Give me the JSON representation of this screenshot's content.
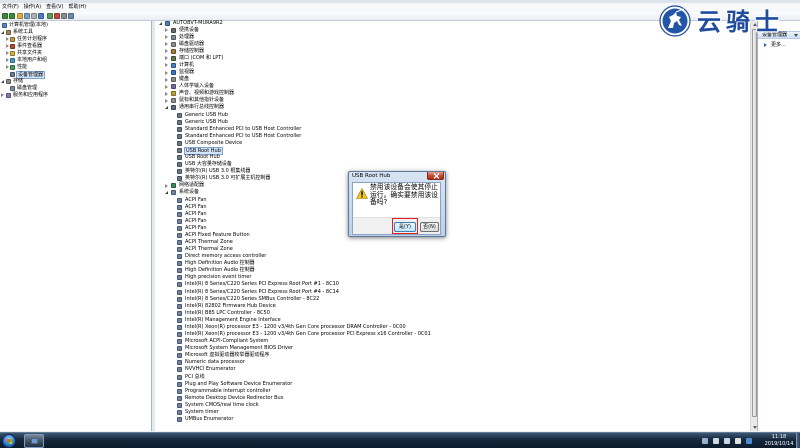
{
  "menu": {
    "items": [
      "文件(F)",
      "操作(A)",
      "查看(V)",
      "帮助(H)"
    ]
  },
  "toolbar": {
    "icons": [
      "back-icon",
      "forward-icon",
      "up-level-icon",
      "show-hide-console-tree-icon",
      "properties-icon",
      "help-icon",
      "update-driver-icon",
      "uninstall-device-icon",
      "disable-device-icon",
      "scan-hardware-changes-icon"
    ]
  },
  "left_tree": [
    {
      "label": "计算机管理(本地)",
      "level": 0,
      "icon": "computer-management-icon"
    },
    {
      "label": "系统工具",
      "level": 1,
      "state": "expanded",
      "icon": "system-tools-icon"
    },
    {
      "label": "任务计划程序",
      "level": 2,
      "state": "collapsed",
      "icon": "task-scheduler-icon"
    },
    {
      "label": "事件查看器",
      "level": 2,
      "state": "collapsed",
      "icon": "event-viewer-icon"
    },
    {
      "label": "共享文件夹",
      "level": 2,
      "state": "collapsed",
      "icon": "shared-folders-icon"
    },
    {
      "label": "本地用户和组",
      "level": 2,
      "state": "collapsed",
      "icon": "local-users-icon"
    },
    {
      "label": "性能",
      "level": 2,
      "state": "collapsed",
      "icon": "performance-icon"
    },
    {
      "label": "设备管理器",
      "level": 2,
      "icon": "device-manager-icon",
      "selected": true
    },
    {
      "label": "存储",
      "level": 1,
      "state": "expanded",
      "icon": "storage-icon"
    },
    {
      "label": "磁盘管理",
      "level": 2,
      "icon": "disk-management-icon"
    },
    {
      "label": "服务和应用程序",
      "level": 1,
      "state": "collapsed",
      "icon": "services-icon"
    }
  ],
  "device_tree": {
    "rows": [
      {
        "label": "AUTOBVT-MURA9R2",
        "level": 0,
        "state": "expanded",
        "icon": "computer-icon"
      },
      {
        "label": "便携设备",
        "level": 1,
        "state": "collapsed",
        "icon": "portable-device-icon"
      },
      {
        "label": "处理器",
        "level": 1,
        "state": "collapsed",
        "icon": "processor-icon"
      },
      {
        "label": "磁盘驱动器",
        "level": 1,
        "state": "collapsed",
        "icon": "disk-drive-icon"
      },
      {
        "label": "存储控制器",
        "level": 1,
        "state": "collapsed",
        "icon": "storage-controller-icon"
      },
      {
        "label": "端口 (COM 和 LPT)",
        "level": 1,
        "state": "collapsed",
        "icon": "port-icon"
      },
      {
        "label": "计算机",
        "level": 1,
        "state": "collapsed",
        "icon": "computer-icon"
      },
      {
        "label": "监视器",
        "level": 1,
        "state": "collapsed",
        "icon": "monitor-icon"
      },
      {
        "label": "键盘",
        "level": 1,
        "state": "collapsed",
        "icon": "keyboard-icon"
      },
      {
        "label": "人体学输入设备",
        "level": 1,
        "state": "collapsed",
        "icon": "hid-icon"
      },
      {
        "label": "声音、视频和游戏控制器",
        "level": 1,
        "state": "collapsed",
        "icon": "sound-icon"
      },
      {
        "label": "鼠标和其他指针设备",
        "level": 1,
        "state": "collapsed",
        "icon": "mouse-icon"
      },
      {
        "label": "通用串行总线控制器",
        "level": 1,
        "state": "expanded",
        "icon": "usb-icon"
      },
      {
        "label": "Generic USB Hub",
        "level": 2,
        "icon": "usb-device-icon"
      },
      {
        "label": "Generic USB Hub",
        "level": 2,
        "icon": "usb-device-icon"
      },
      {
        "label": "Standard Enhanced PCI to USB Host Controller",
        "level": 2,
        "icon": "usb-device-icon"
      },
      {
        "label": "Standard Enhanced PCI to USB Host Controller",
        "level": 2,
        "icon": "usb-device-icon"
      },
      {
        "label": "USB Composite Device",
        "level": 2,
        "icon": "usb-device-icon"
      },
      {
        "label": "USB Root Hub",
        "level": 2,
        "icon": "usb-device-icon",
        "selected": true
      },
      {
        "label": "USB Root Hub",
        "level": 2,
        "icon": "usb-device-icon"
      },
      {
        "label": "USB 大容量存储设备",
        "level": 2,
        "icon": "usb-device-icon"
      },
      {
        "label": "英特尔(R) USB 3.0 根集线器",
        "level": 2,
        "icon": "usb-device-icon"
      },
      {
        "label": "英特尔(R) USB 3.0 可扩展主机控制器",
        "level": 2,
        "icon": "usb-device-icon"
      },
      {
        "label": "网络适配器",
        "level": 1,
        "state": "collapsed",
        "icon": "network-adapter-icon"
      },
      {
        "label": "系统设备",
        "level": 1,
        "state": "expanded",
        "icon": "system-device-icon"
      },
      {
        "label": "ACPI Fan",
        "level": 2,
        "icon": "system-device-icon"
      },
      {
        "label": "ACPI Fan",
        "level": 2,
        "icon": "system-device-icon"
      },
      {
        "label": "ACPI Fan",
        "level": 2,
        "icon": "system-device-icon"
      },
      {
        "label": "ACPI Fan",
        "level": 2,
        "icon": "system-device-icon"
      },
      {
        "label": "ACPI Fan",
        "level": 2,
        "icon": "system-device-icon"
      },
      {
        "label": "ACPI Fixed Feature Button",
        "level": 2,
        "icon": "system-device-icon"
      },
      {
        "label": "ACPI Thermal Zone",
        "level": 2,
        "icon": "system-device-icon"
      },
      {
        "label": "ACPI Thermal Zone",
        "level": 2,
        "icon": "system-device-icon"
      },
      {
        "label": "Direct memory access controller",
        "level": 2,
        "icon": "system-device-icon"
      },
      {
        "label": "High Definition Audio 控制器",
        "level": 2,
        "icon": "system-device-icon"
      },
      {
        "label": "High Definition Audio 控制器",
        "level": 2,
        "icon": "system-device-icon"
      },
      {
        "label": "High precision event timer",
        "level": 2,
        "icon": "system-device-icon"
      },
      {
        "label": "Intel(R) 8 Series/C220 Series PCI Express Root Port #1 - 8C10",
        "level": 2,
        "icon": "system-device-icon"
      },
      {
        "label": "Intel(R) 8 Series/C220 Series PCI Express Root Port #4 - 8C14",
        "level": 2,
        "icon": "system-device-icon"
      },
      {
        "label": "Intel(R) 8 Series/C220 Series SMBus Controller - 8C22",
        "level": 2,
        "icon": "system-device-icon"
      },
      {
        "label": "Intel(R) 82802 Firmware Hub Device",
        "level": 2,
        "icon": "system-device-icon"
      },
      {
        "label": "Intel(R) B85 LPC Controller - 8C50",
        "level": 2,
        "icon": "system-device-icon"
      },
      {
        "label": "Intel(R) Management Engine Interface",
        "level": 2,
        "icon": "system-device-icon"
      },
      {
        "label": "Intel(R) Xeon(R) processor E3 - 1200 v3/4th Gen Core processor DRAM Controller - 0C00",
        "level": 2,
        "icon": "system-device-icon"
      },
      {
        "label": "Intel(R) Xeon(R) processor E3 - 1200 v3/4th Gen Core processor PCI Express x16 Controller - 0C01",
        "level": 2,
        "icon": "system-device-icon"
      },
      {
        "label": "Microsoft ACPI-Compliant System",
        "level": 2,
        "icon": "system-device-icon"
      },
      {
        "label": "Microsoft System Management BIOS Driver",
        "level": 2,
        "icon": "system-device-icon"
      },
      {
        "label": "Microsoft 虚拟驱动器枚举器驱动程序",
        "level": 2,
        "icon": "system-device-icon"
      },
      {
        "label": "Numeric data processor",
        "level": 2,
        "icon": "system-device-icon"
      },
      {
        "label": "NVVHCI Enumerator",
        "level": 2,
        "icon": "system-device-icon"
      },
      {
        "label": "PCI 总线",
        "level": 2,
        "icon": "system-device-icon"
      },
      {
        "label": "Plug and Play Software Device Enumerator",
        "level": 2,
        "icon": "system-device-icon"
      },
      {
        "label": "Programmable interrupt controller",
        "level": 2,
        "icon": "system-device-icon"
      },
      {
        "label": "Remote Desktop Device Redirector Bus",
        "level": 2,
        "icon": "system-device-icon"
      },
      {
        "label": "System CMOS/real time clock",
        "level": 2,
        "icon": "system-device-icon"
      },
      {
        "label": "System timer",
        "level": 2,
        "icon": "system-device-icon"
      },
      {
        "label": "UMBus Enumerator",
        "level": 2,
        "icon": "system-device-icon"
      }
    ]
  },
  "actions": {
    "section_label": "设备管理器",
    "more_label": "更多..."
  },
  "dialog": {
    "title": "USB Root Hub",
    "icon": "warning-icon",
    "message_lines": [
      "禁用该设备会使其停止",
      "运行。确实要禁用该设",
      "备吗?"
    ],
    "yes_label": "是(Y)",
    "no_label": "否(N)",
    "highlight_color": "#e01f1f"
  },
  "watermark": {
    "text": "云骑士",
    "color": "#1f4c9c"
  },
  "taskbar": {
    "app_icon": "computer-management-app-icon",
    "tray_icons": [
      "show-hidden-icons-icon",
      "action-center-icon",
      "network-icon",
      "volume-icon",
      "input-method-icon"
    ],
    "time": "11:18",
    "date": "2019/10/14"
  }
}
